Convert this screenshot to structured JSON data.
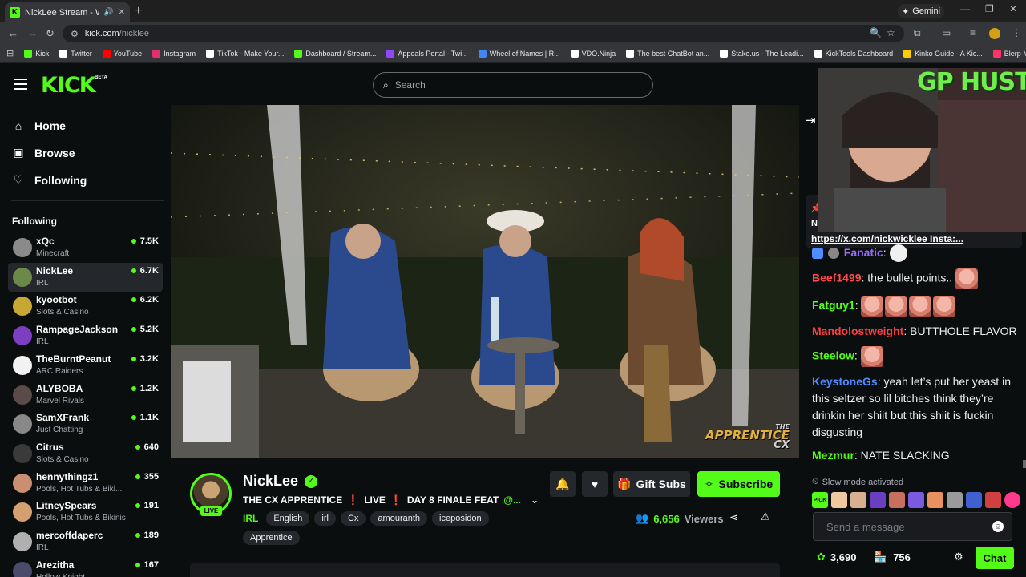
{
  "browser": {
    "tab_title": "NickLee Stream - Watch Li...",
    "new_tab": "+",
    "gemini_label": "Gemini",
    "url_host": "kick.com",
    "url_path": "/nicklee",
    "bookmarks": [
      {
        "label": "Kick",
        "color": "#53fc18"
      },
      {
        "label": "Twitter",
        "color": "#ffffff"
      },
      {
        "label": "YouTube",
        "color": "#ff0000"
      },
      {
        "label": "Instagram",
        "color": "#e1306c"
      },
      {
        "label": "TikTok - Make Your...",
        "color": "#ffffff"
      },
      {
        "label": "Dashboard / Stream...",
        "color": "#53fc18"
      },
      {
        "label": "Appeals Portal - Twi...",
        "color": "#9146ff"
      },
      {
        "label": "Wheel of Names | R...",
        "color": "#4285f4"
      },
      {
        "label": "VDO.Ninja",
        "color": "#ffffff"
      },
      {
        "label": "The best ChatBot an...",
        "color": "#ffffff"
      },
      {
        "label": "Stake.us - The Leadi...",
        "color": "#ffffff"
      },
      {
        "label": "KickTools Dashboard",
        "color": "#ffffff"
      },
      {
        "label": "Kinko Guide - A Kic...",
        "color": "#ffcc00"
      },
      {
        "label": "Blerp Memes | Best...",
        "color": "#ff3366"
      }
    ]
  },
  "header": {
    "logo": "KICK",
    "beta": "BETA",
    "search_placeholder": "Search"
  },
  "sidebar": {
    "nav": [
      {
        "label": "Home",
        "icon": "home-icon"
      },
      {
        "label": "Browse",
        "icon": "browse-icon"
      },
      {
        "label": "Following",
        "icon": "heart-icon"
      }
    ],
    "following_header": "Following",
    "channels": [
      {
        "name": "xQc",
        "category": "Minecraft",
        "viewers": "7.5K",
        "avatar": "#8a8a8a"
      },
      {
        "name": "NickLee",
        "category": "IRL",
        "viewers": "6.7K",
        "avatar": "#6b8a4a"
      },
      {
        "name": "kyootbot",
        "category": "Slots & Casino",
        "viewers": "6.2K",
        "avatar": "#c7a832"
      },
      {
        "name": "RampageJackson",
        "category": "IRL",
        "viewers": "5.2K",
        "avatar": "#7b3fbf"
      },
      {
        "name": "TheBurntPeanut",
        "category": "ARC Raiders",
        "viewers": "3.2K",
        "avatar": "#f2f2f2"
      },
      {
        "name": "ALYBOBA",
        "category": "Marvel Rivals",
        "viewers": "1.2K",
        "avatar": "#5a4a4a"
      },
      {
        "name": "SamXFrank",
        "category": "Just Chatting",
        "viewers": "1.1K",
        "avatar": "#888888"
      },
      {
        "name": "Citrus",
        "category": "Slots & Casino",
        "viewers": "640",
        "avatar": "#3a3a3a"
      },
      {
        "name": "hennythingz1",
        "category": "Pools, Hot Tubs & Biki...",
        "viewers": "355",
        "avatar": "#c89070"
      },
      {
        "name": "LitneySpears",
        "category": "Pools, Hot Tubs & Bikinis",
        "viewers": "191",
        "avatar": "#d4a070"
      },
      {
        "name": "mercoffdaperc",
        "category": "IRL",
        "viewers": "189",
        "avatar": "#b0b0b0"
      },
      {
        "name": "Arezitha",
        "category": "Hollow Knight",
        "viewers": "167",
        "avatar": "#4a4a6a"
      }
    ]
  },
  "video": {
    "watermark_top": "THE",
    "watermark_mid": "APPRENTICE",
    "watermark_bot": "CX"
  },
  "stream": {
    "streamer": "NickLee",
    "live_badge": "LIVE",
    "title_part1": "THE CX APPRENTICE",
    "bang1": "❗",
    "title_part2": "LIVE",
    "bang2": "❗",
    "title_part3": "DAY 8 FINALE FEAT",
    "title_mention": "@...",
    "category": "IRL",
    "tags": [
      "English",
      "irl",
      "Cx",
      "amouranth",
      "iceposidon",
      "Apprentice"
    ],
    "gift_label": "Gift Subs",
    "subscribe_label": "Subscribe",
    "viewer_count": "6,656",
    "viewers_label": "Viewers"
  },
  "chat": {
    "pinned_n": "N",
    "pinned_link": "https://x.com/nickwicklee",
    "pinned_rest": " Insta:...",
    "webcam_text": "GP HUSTLA",
    "messages": [
      {
        "user": "Fanatic",
        "color": "#9b6bff",
        "text": ":"
      },
      {
        "user": "Beef1499",
        "color": "#ff4d4d",
        "text": ": the bullet points.."
      },
      {
        "user": "Fatguy1",
        "color": "#53fc18",
        "text": ":"
      },
      {
        "user": "Mandolostweight",
        "color": "#ff3d3d",
        "text": ": BUTTHOLE FLAVOR"
      },
      {
        "user": "Steelow",
        "color": "#53fc18",
        "text": ":"
      },
      {
        "user": "KeystoneGs",
        "color": "#4f8cff",
        "text": ": yeah let’s put her yeast in this seltzer so lil bitches think they’re drinkin her shiit but this shiit is fuckin disgusting"
      },
      {
        "user": "Mezmur",
        "color": "#53fc18",
        "text": ": NATE SLACKING"
      }
    ],
    "slow_mode": "Slow mode activated",
    "input_placeholder": "Send a message",
    "points": "3,690",
    "store_count": "756",
    "chat_button": "Chat"
  }
}
